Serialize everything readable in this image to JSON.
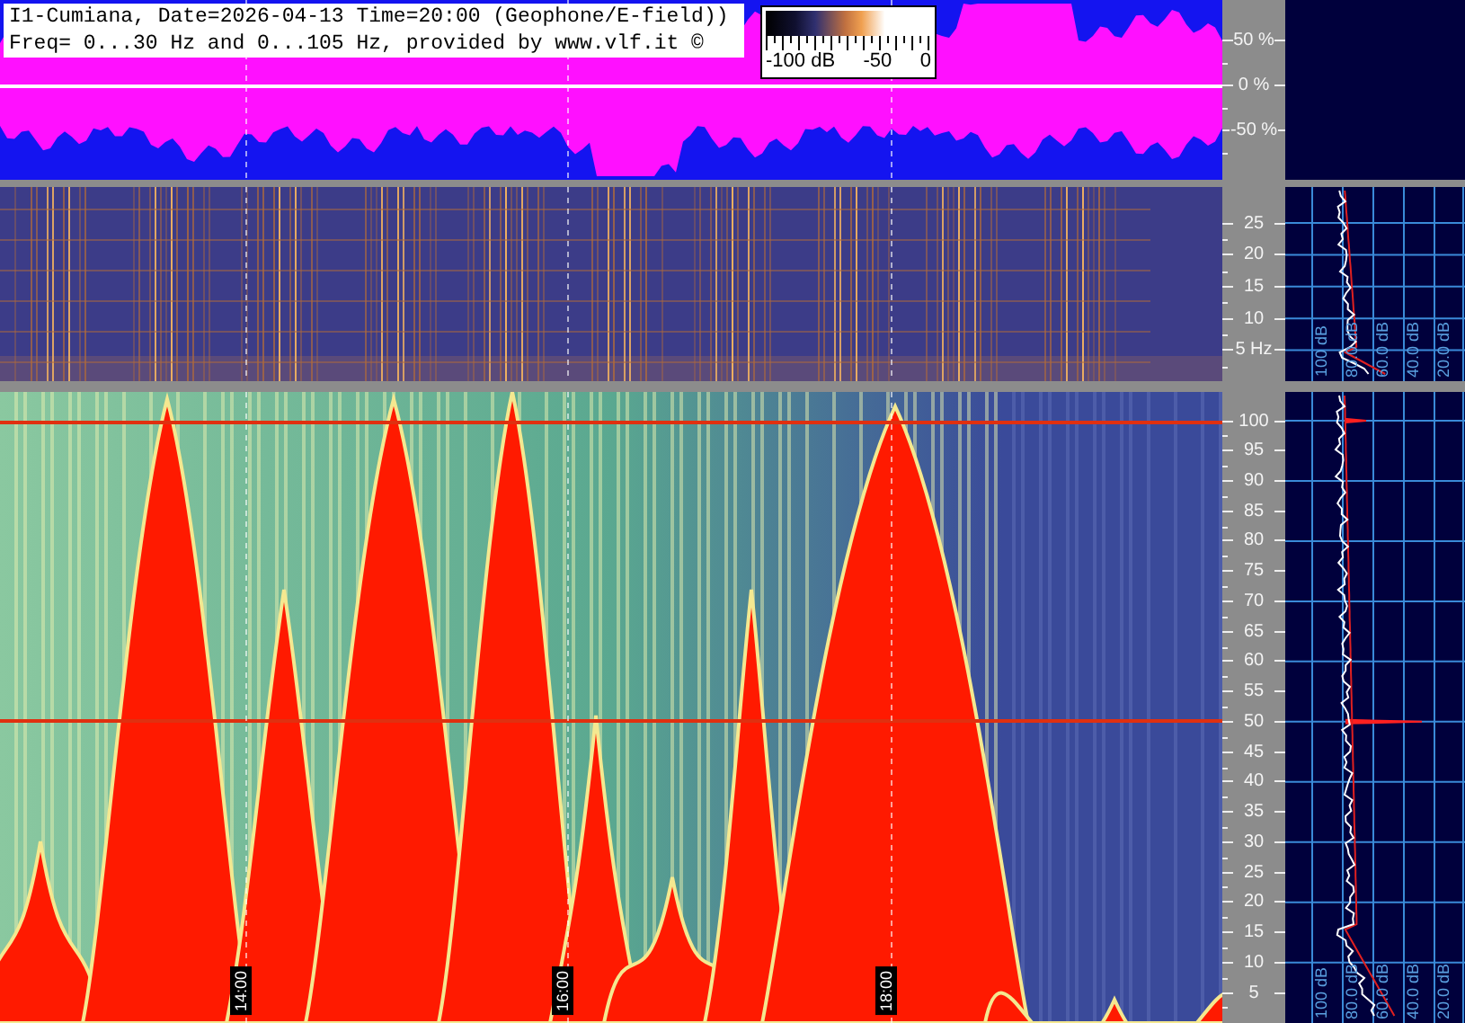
{
  "header": {
    "title_line": "I1-Cumiana, Date=2026-04-13 Time=20:00 (Geophone/E-field))",
    "info_line": "Freq= 0...30 Hz and 0...105 Hz, provided by www.vlf.it ©"
  },
  "color_scale": {
    "labels": [
      "-100 dB",
      "-50",
      "0"
    ]
  },
  "waveform_panel": {
    "axis_labels": [
      "50 %",
      "0 %",
      "-50 %"
    ]
  },
  "low_spectrogram": {
    "axis_labels": [
      "25",
      "20",
      "15",
      "10",
      "5 Hz"
    ],
    "spectrum_labels": [
      "100 dB",
      "80.0 dB",
      "60.0 dB",
      "40.0 dB",
      "20.0 dB"
    ]
  },
  "high_spectrogram": {
    "axis_labels": [
      "100",
      "95",
      "90",
      "85",
      "80",
      "75",
      "70",
      "65",
      "60",
      "55",
      "50",
      "45",
      "40",
      "35",
      "30",
      "25",
      "20",
      "15",
      "10",
      "5"
    ],
    "time_labels": [
      "14:00",
      "16:00",
      "18:00"
    ],
    "spectrum_labels": [
      "100 dB",
      "80.0 dB",
      "60.0 dB",
      "40.0 dB",
      "20.0 dB"
    ]
  }
}
